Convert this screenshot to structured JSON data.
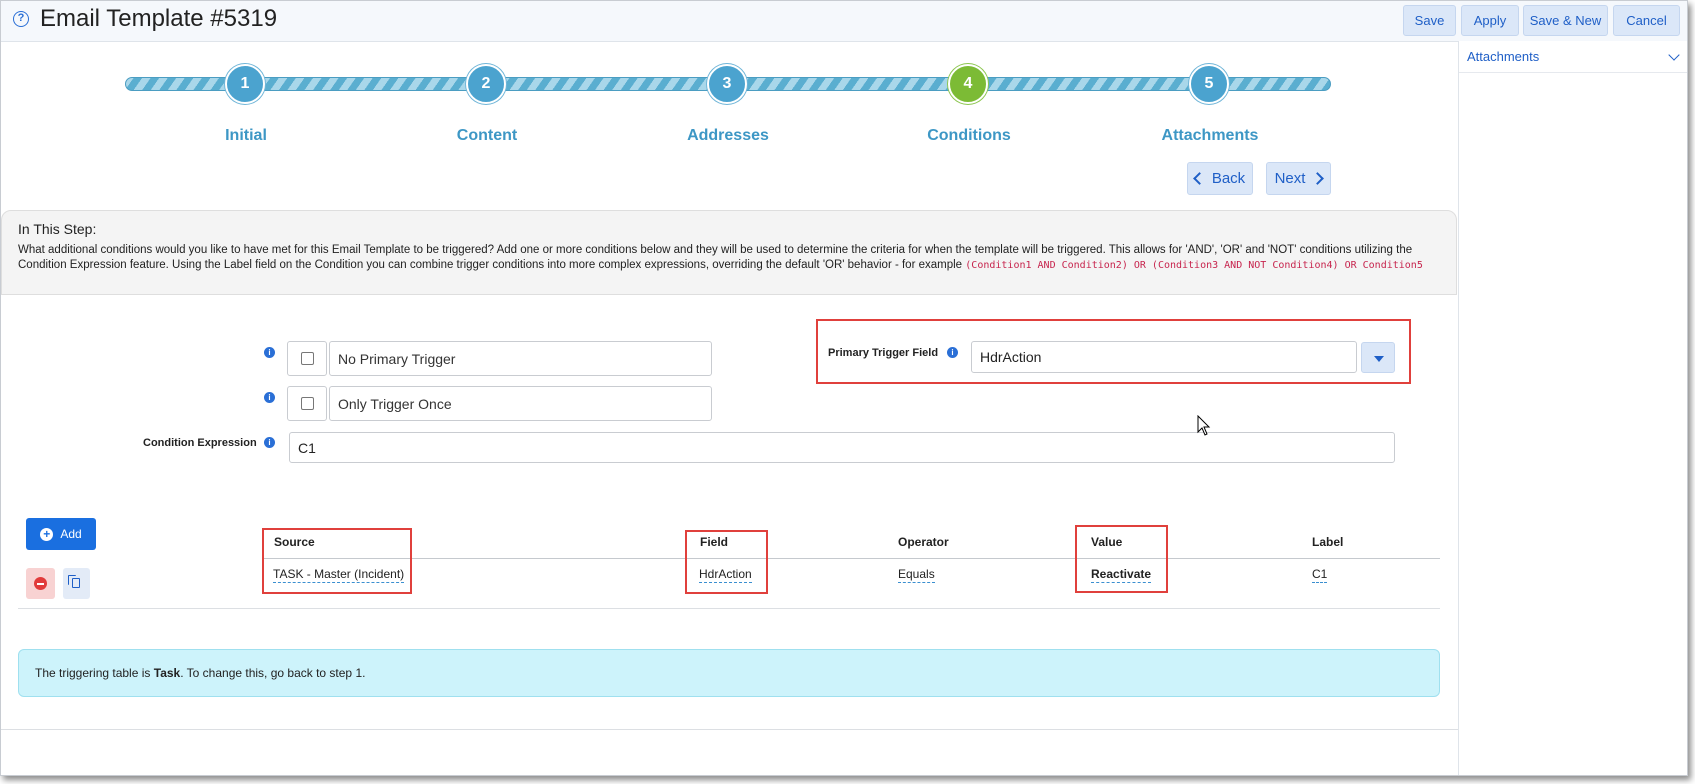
{
  "header": {
    "title": "Email Template #5319",
    "help_icon": "help-circle-icon",
    "buttons": {
      "save": "Save",
      "apply": "Apply",
      "save_new": "Save & New",
      "cancel": "Cancel"
    }
  },
  "right_panel": {
    "title": "Attachments",
    "icon": "chevron-down-icon"
  },
  "wizard": {
    "steps": [
      {
        "number": "1",
        "label": "Initial"
      },
      {
        "number": "2",
        "label": "Content"
      },
      {
        "number": "3",
        "label": "Addresses"
      },
      {
        "number": "4",
        "label": "Conditions"
      },
      {
        "number": "5",
        "label": "Attachments"
      }
    ],
    "active_step": 4,
    "back_label": "Back",
    "next_label": "Next"
  },
  "info": {
    "title": "In This Step:",
    "text": "What additional conditions would you like to have met for this Email Template to be triggered? Add one or more conditions below and they will be used to determine the criteria for when the template will be triggered. This allows for 'AND', 'OR' and 'NOT' conditions utilizing the Condition Expression feature. Using the Label field on the Condition you can combine trigger conditions into more complex expressions, overriding the default 'OR' behavior - for example ",
    "code": "(Condition1 AND Condition2) OR (Condition3 AND NOT Condition4) OR Condition5"
  },
  "form": {
    "no_primary_trigger": "No Primary Trigger",
    "only_trigger_once": "Only Trigger Once",
    "primary_trigger_label": "Primary Trigger Field",
    "primary_trigger_value": "HdrAction",
    "condition_expression_label": "Condition Expression",
    "condition_expression_value": "C1"
  },
  "table": {
    "add_label": "Add",
    "headers": {
      "source": "Source",
      "field": "Field",
      "operator": "Operator",
      "value": "Value",
      "label": "Label"
    },
    "rows": [
      {
        "source": "TASK - Master (Incident)",
        "field": "HdrAction",
        "operator": "Equals",
        "value": "Reactivate",
        "label": "C1"
      }
    ]
  },
  "alert": {
    "prefix": "The triggering table is ",
    "table": "Task",
    "suffix": ". To change this, go back to step 1."
  },
  "colors": {
    "accent": "#1a6fe0",
    "step": "#4ba3cf",
    "step_active": "#7cbb35",
    "highlight": "#e0403c"
  }
}
